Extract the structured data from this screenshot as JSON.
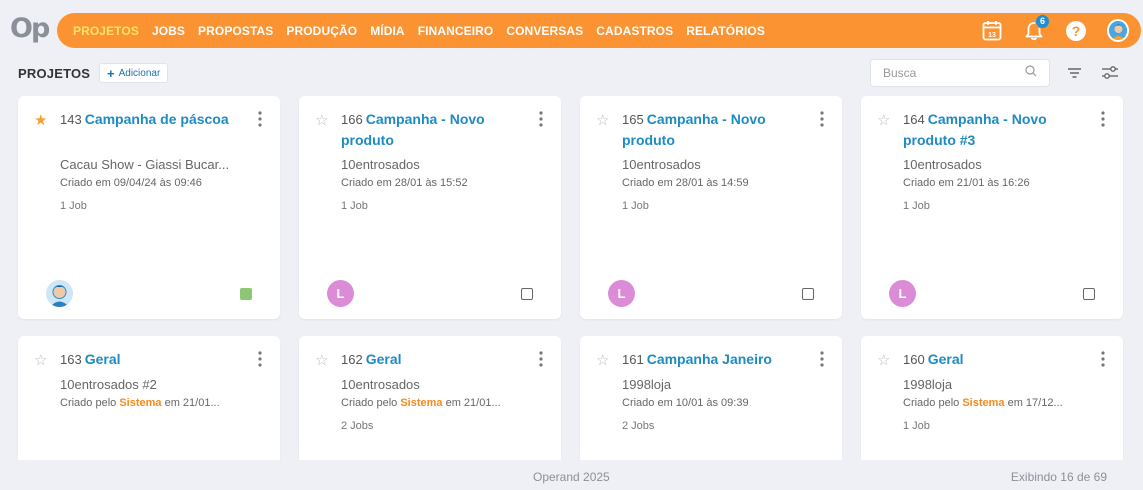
{
  "app": {
    "logo": "Op"
  },
  "nav": {
    "items": [
      "PROJETOS",
      "JOBS",
      "PROPOSTAS",
      "PRODUÇÃO",
      "MÍDIA",
      "FINANCEIRO",
      "CONVERSAS",
      "CADASTROS",
      "RELATÓRIOS"
    ],
    "active": "PROJETOS",
    "calendar_day": "13",
    "notification_count": "6",
    "help_label": "?"
  },
  "toolbar": {
    "title": "PROJETOS",
    "add_label": "Adicionar",
    "search_placeholder": "Busca"
  },
  "cards": [
    {
      "number": "143",
      "title": "Campanha de páscoa",
      "client": "Cacau Show - Giassi Bucar...",
      "created_prefix": "Criado em 09/04/24 às 09:46",
      "created_by": "",
      "created_suffix": "",
      "jobs": "1 Job",
      "favorite": true,
      "owner": "photo",
      "owner_initial": "",
      "marker": "status"
    },
    {
      "number": "166",
      "title": "Campanha - Novo produto",
      "client": "10entrosados",
      "created_prefix": "Criado em 28/01 às 15:52",
      "created_by": "",
      "created_suffix": "",
      "jobs": "1 Job",
      "favorite": false,
      "owner": "initial",
      "owner_initial": "L",
      "marker": "checkbox"
    },
    {
      "number": "165",
      "title": "Campanha - Novo produto",
      "client": "10entrosados",
      "created_prefix": "Criado em 28/01 às 14:59",
      "created_by": "",
      "created_suffix": "",
      "jobs": "1 Job",
      "favorite": false,
      "owner": "initial",
      "owner_initial": "L",
      "marker": "checkbox"
    },
    {
      "number": "164",
      "title": "Campanha - Novo produto #3",
      "client": "10entrosados",
      "created_prefix": "Criado em 21/01 às 16:26",
      "created_by": "",
      "created_suffix": "",
      "jobs": "1 Job",
      "favorite": false,
      "owner": "initial",
      "owner_initial": "L",
      "marker": "checkbox"
    },
    {
      "number": "163",
      "title": "Geral",
      "client": "10entrosados #2",
      "created_prefix": "Criado pelo ",
      "created_by": "Sistema",
      "created_suffix": " em 21/01...",
      "jobs": "",
      "favorite": false,
      "owner": "",
      "owner_initial": "",
      "marker": ""
    },
    {
      "number": "162",
      "title": "Geral",
      "client": "10entrosados",
      "created_prefix": "Criado pelo ",
      "created_by": "Sistema",
      "created_suffix": " em 21/01...",
      "jobs": "2 Jobs",
      "favorite": false,
      "owner": "",
      "owner_initial": "",
      "marker": ""
    },
    {
      "number": "161",
      "title": "Campanha Janeiro",
      "client": "1998loja",
      "created_prefix": "Criado em 10/01 às 09:39",
      "created_by": "",
      "created_suffix": "",
      "jobs": "2 Jobs",
      "favorite": false,
      "owner": "",
      "owner_initial": "",
      "marker": ""
    },
    {
      "number": "160",
      "title": "Geral",
      "client": "1998loja",
      "created_prefix": "Criado pelo ",
      "created_by": "Sistema",
      "created_suffix": " em 17/12...",
      "jobs": "1 Job",
      "favorite": false,
      "owner": "",
      "owner_initial": "",
      "marker": ""
    }
  ],
  "footer": {
    "copyright": "Operand 2025",
    "showing": "Exibindo 16 de 69"
  },
  "colors": {
    "accent": "#fb9333",
    "active_nav": "#ffe36a",
    "link": "#1e8bc3",
    "badge": "#1e8fd6",
    "favorite": "#f7a02d",
    "status_green": "#8fc671",
    "avatar_pink": "#dc8bd6",
    "system_orange": "#f58a1f"
  }
}
